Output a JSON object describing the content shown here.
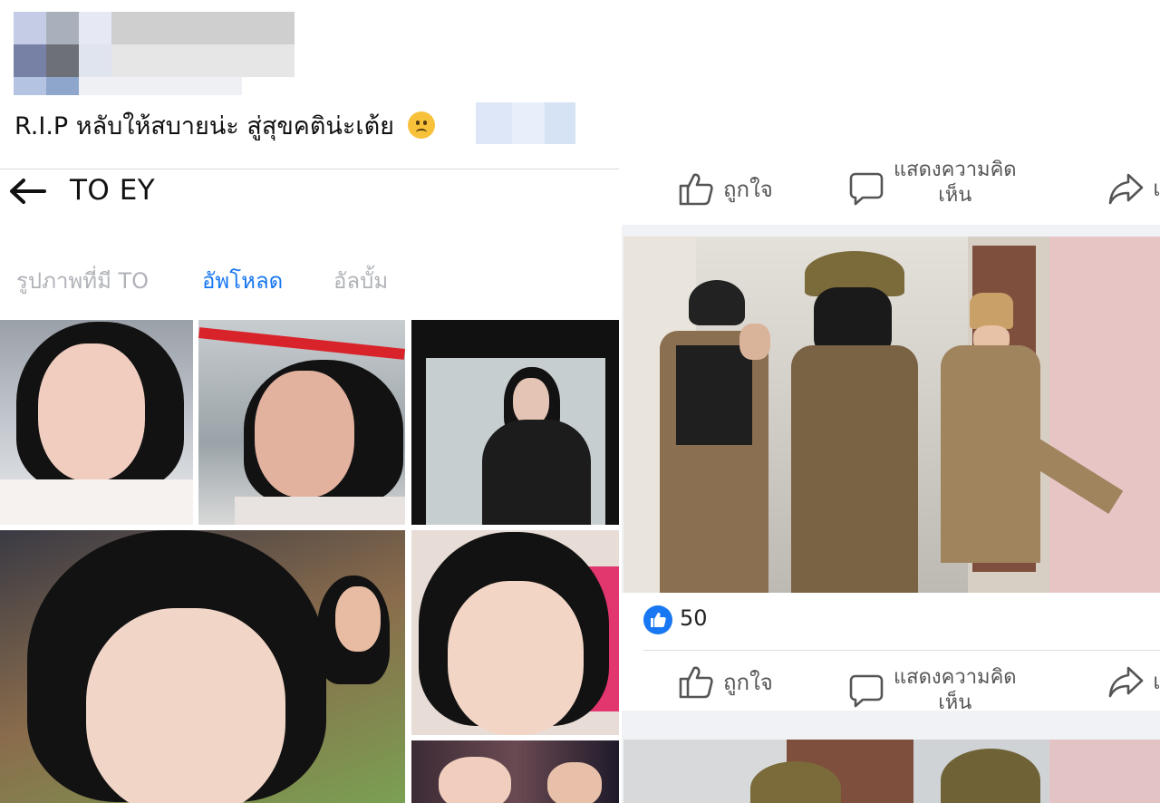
{
  "post": {
    "text": "R.I.P หลับให้สบายน่ะ สู่สุขคติน่ะเต้ย",
    "emoji": "frowning-face"
  },
  "profile": {
    "name": "TO EY",
    "tabs": [
      {
        "label": "รูปภาพที่มี TO",
        "active": false
      },
      {
        "label": "อัพโหลด",
        "active": true
      },
      {
        "label": "อัลบั้ม",
        "active": false
      }
    ]
  },
  "feed": {
    "actions": {
      "like": "ถูกใจ",
      "comment_line1": "แสดงความคิด",
      "comment_line2": "เห็น",
      "share": "แ"
    },
    "reactions": {
      "count": "50",
      "icon": "thumbs-up-icon"
    }
  },
  "colors": {
    "accent": "#1877f2",
    "inactive_tab": "#b0b3b8",
    "feed_background": "#f0f2f5",
    "police_uniform": "#8a6f50"
  }
}
